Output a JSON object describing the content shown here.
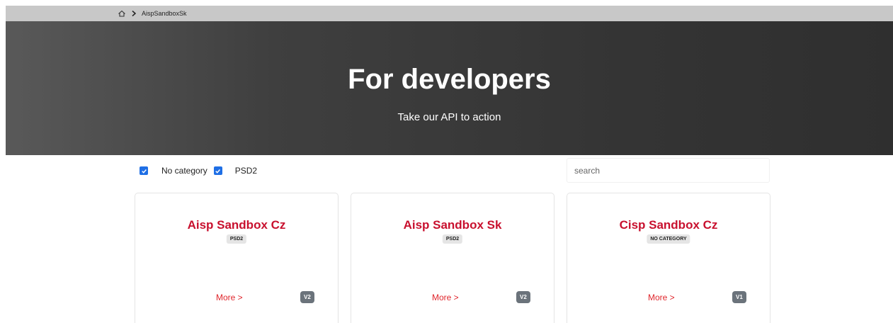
{
  "breadcrumb": {
    "items": [
      "AispSandboxSk"
    ]
  },
  "hero": {
    "title": "For developers",
    "subtitle": "Take our API to action"
  },
  "filters": [
    {
      "label": "No category",
      "checked": true
    },
    {
      "label": "PSD2",
      "checked": true
    }
  ],
  "search": {
    "placeholder": "search",
    "value": ""
  },
  "cards": [
    {
      "title": "Aisp Sandbox Cz",
      "category": "PSD2",
      "more_label": "More >",
      "version": "V2"
    },
    {
      "title": "Aisp Sandbox Sk",
      "category": "PSD2",
      "more_label": "More >",
      "version": "V2"
    },
    {
      "title": "Cisp Sandbox Cz",
      "category": "NO CATEGORY",
      "more_label": "More >",
      "version": "V1"
    }
  ],
  "colors": {
    "accent": "#c8102e",
    "link": "#e0262c",
    "checkbox": "#1f6fe5",
    "badge_dark": "#6b737b"
  },
  "icons": {
    "home": "home-icon",
    "separator": "chevron-right-icon"
  }
}
